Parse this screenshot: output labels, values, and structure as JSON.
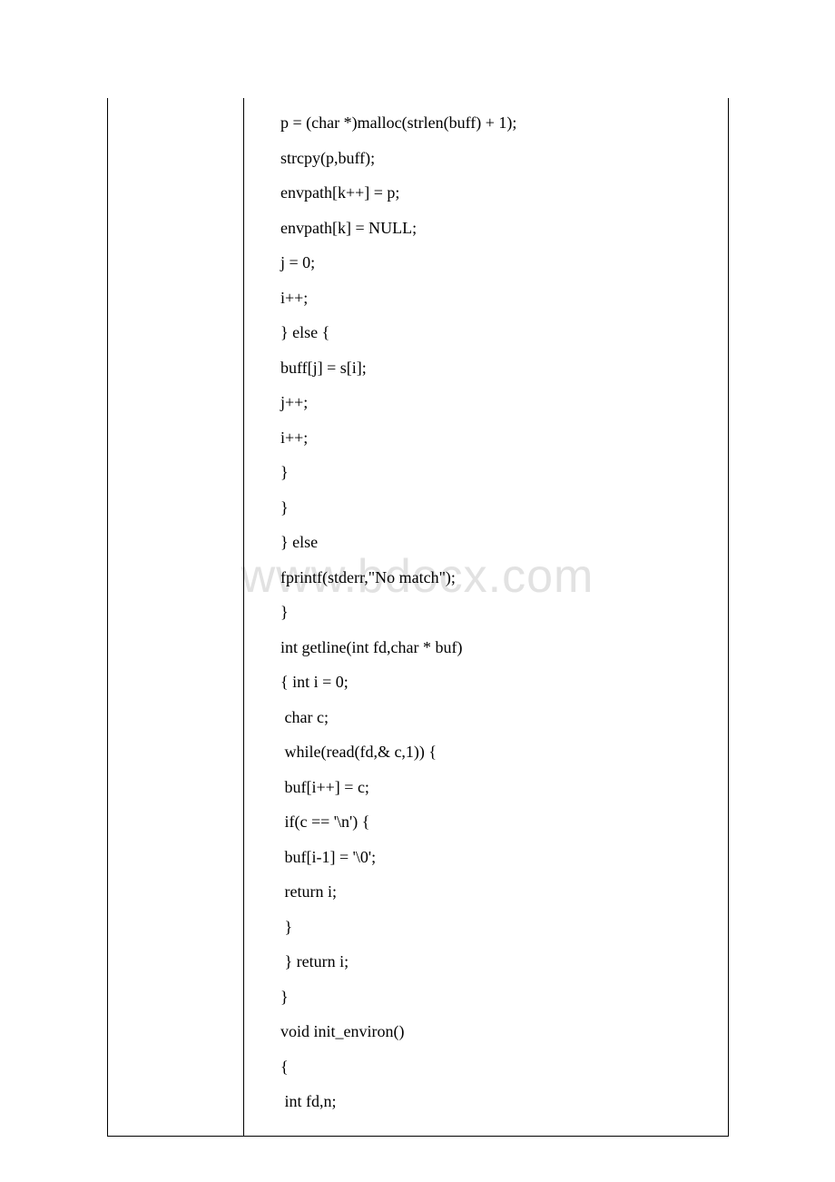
{
  "watermark": "www.bdocx.com",
  "code_lines": [
    "p = (char *)malloc(strlen(buff) + 1);",
    "strcpy(p,buff);",
    "envpath[k++] = p;",
    "envpath[k] = NULL;",
    "j = 0;",
    "i++;",
    "} else {",
    "buff[j] = s[i];",
    "j++;",
    "i++;",
    "}",
    "}",
    "} else",
    "fprintf(stderr,\"No match\");",
    "}",
    "int getline(int fd,char * buf)",
    "{ int i = 0;",
    " char c;",
    " while(read(fd,& c,1)) {",
    " buf[i++] = c;",
    " if(c == '\\n') {",
    " buf[i-1] = '\\0';",
    " return i;",
    " }",
    " } return i;",
    "}",
    "void init_environ()",
    "{",
    " int fd,n;"
  ]
}
